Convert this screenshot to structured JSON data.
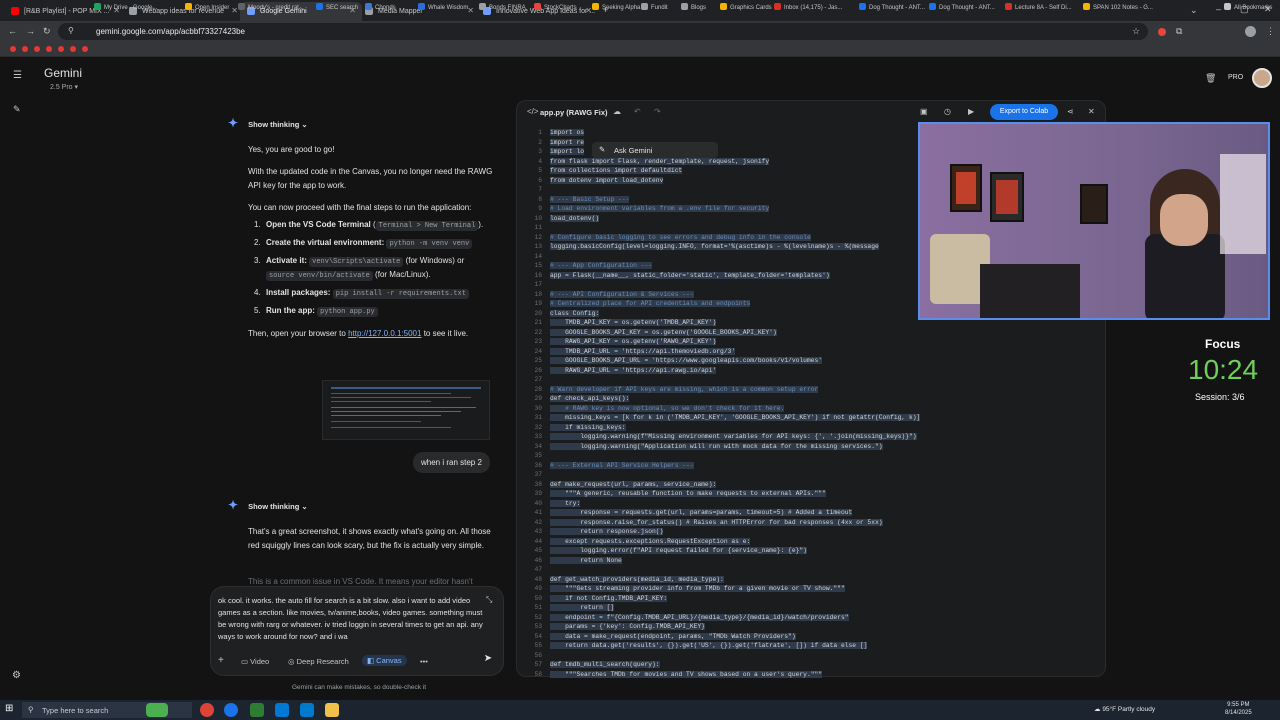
{
  "browser": {
    "tabs": [
      {
        "label": "[R&B Playlist] - POP MIX ...",
        "active": false
      },
      {
        "label": "Webapp ideas for revenue",
        "active": false
      },
      {
        "label": "Google Gemini",
        "active": true
      },
      {
        "label": "Media Mapper",
        "active": false
      },
      {
        "label": "Innovative Web App Ideas for ...",
        "active": false
      }
    ],
    "url": "gemini.google.com/app/acbbf73327423be",
    "bookmarks": [
      "My Drive - Google...",
      "Open Insider",
      "Moody's - credit rat...",
      "SEC search",
      "Cbonds",
      "Whale Wisdom",
      "Bonds FINRA",
      "StockCharts",
      "Seeking Alpha",
      "Fundit",
      "Blogs",
      "Graphics Cards",
      "Inbox (14,175) - Jas...",
      "Dog Thought - ANT...",
      "Dog Thought - ANT...",
      "Lecture 8A - Self Di...",
      "SPAN 102 Notes - G..."
    ],
    "all_bookmarks": "All Bookmarks"
  },
  "gemini": {
    "title": "Gemini",
    "model": "2.5 Pro",
    "pro_badge": "PRO",
    "show_thinking": "Show thinking",
    "intro_1": "Yes, you are good to go!",
    "intro_2": "With the updated code in the Canvas, you no longer need the RAWG API key for the app to work.",
    "intro_3": "You can now proceed with the final steps to run the application:",
    "steps": [
      {
        "n": "1.",
        "label": "Open the VS Code Terminal",
        "tail": " (",
        "code": "Terminal > New Terminal",
        "end": ")."
      },
      {
        "n": "2.",
        "label": "Create the virtual environment:",
        "tail": " ",
        "code": "python -m venv venv",
        "end": ""
      },
      {
        "n": "3.",
        "label": "Activate it:",
        "tail": " ",
        "code": "venv\\Scripts\\activate",
        "end": " (for Windows) or"
      },
      {
        "n": "",
        "label": "",
        "tail": "",
        "code": "source venv/bin/activate",
        "end": " (for Mac/Linux)."
      },
      {
        "n": "4.",
        "label": "Install packages:",
        "tail": " ",
        "code": "pip install -r requirements.txt",
        "end": ""
      },
      {
        "n": "5.",
        "label": "Run the app:",
        "tail": " ",
        "code": "python app.py",
        "end": ""
      }
    ],
    "then_text": "Then, open your browser to ",
    "then_link": "http://127.0.0.1:5001",
    "then_end": " to see it live.",
    "user_message": "when i ran step 2",
    "reply_1": "That's a great screenshot, it shows exactly what's going on. All those red squiggly lines can look scary, but the fix is actually very simple.",
    "reply_2": "This is a common issue in VS Code. It means your editor hasn't",
    "input_value": "ok cool. it works. the auto fill for search is a bit slow. also i want to add video games as a section. like movies, tv/anime,books, video games. something must be wrong with rarg or whatever. iv tried loggin in several times to get an api. any ways to work around for now? and i wa",
    "tools": {
      "video": "Video",
      "deep_research": "Deep Research",
      "canvas": "Canvas",
      "more": "•••"
    },
    "disclaimer": "Gemini can make mistakes, so double-check it"
  },
  "canvas": {
    "title": "app.py (RAWG Fix)",
    "export_label": "Export to Colab",
    "ask_gemini": "Ask Gemini",
    "code_lines": [
      {
        "n": "1",
        "t": "import os",
        "c": false
      },
      {
        "n": "2",
        "t": "import re",
        "c": false
      },
      {
        "n": "3",
        "t": "import lo",
        "c": false
      },
      {
        "n": "4",
        "t": "from flask import Flask, render_template, request, jsonify",
        "c": false
      },
      {
        "n": "5",
        "t": "from collections import defaultdict",
        "c": false
      },
      {
        "n": "6",
        "t": "from dotenv import load_dotenv",
        "c": false
      },
      {
        "n": "7",
        "t": "",
        "c": false
      },
      {
        "n": "8",
        "t": "# --- Basic Setup ---",
        "c": true
      },
      {
        "n": "9",
        "t": "# Load environment variables from a .env file for security",
        "c": true
      },
      {
        "n": "10",
        "t": "load_dotenv()",
        "c": false
      },
      {
        "n": "11",
        "t": "",
        "c": false
      },
      {
        "n": "12",
        "t": "# Configure basic logging to see errors and debug info in the console",
        "c": true
      },
      {
        "n": "13",
        "t": "logging.basicConfig(level=logging.INFO, format='%(asctime)s - %(levelname)s - %(message",
        "c": false
      },
      {
        "n": "14",
        "t": "",
        "c": false
      },
      {
        "n": "15",
        "t": "# --- App Configuration ---",
        "c": true
      },
      {
        "n": "16",
        "t": "app = Flask(__name__, static_folder='static', template_folder='templates')",
        "c": false
      },
      {
        "n": "17",
        "t": "",
        "c": false
      },
      {
        "n": "18",
        "t": "# --- API Configuration & Services ---",
        "c": true
      },
      {
        "n": "19",
        "t": "# Centralized place for API credentials and endpoints",
        "c": true
      },
      {
        "n": "20",
        "t": "class Config:",
        "c": false
      },
      {
        "n": "21",
        "t": "    TMDB_API_KEY = os.getenv('TMDB_API_KEY')",
        "c": false
      },
      {
        "n": "22",
        "t": "    GOOGLE_BOOKS_API_KEY = os.getenv('GOOGLE_BOOKS_API_KEY')",
        "c": false
      },
      {
        "n": "23",
        "t": "    RAWG_API_KEY = os.getenv('RAWG_API_KEY')",
        "c": false
      },
      {
        "n": "24",
        "t": "    TMDB_API_URL = 'https://api.themoviedb.org/3'",
        "c": false
      },
      {
        "n": "25",
        "t": "    GOOGLE_BOOKS_API_URL = 'https://www.googleapis.com/books/v1/volumes'",
        "c": false
      },
      {
        "n": "26",
        "t": "    RAWG_API_URL = 'https://api.rawg.io/api'",
        "c": false
      },
      {
        "n": "27",
        "t": "",
        "c": false
      },
      {
        "n": "28",
        "t": "# Warn developer if API keys are missing, which is a common setup error",
        "c": true
      },
      {
        "n": "29",
        "t": "def check_api_keys():",
        "c": false
      },
      {
        "n": "30",
        "t": "    # RAWG key is now optional, so we don't check for it here.",
        "c": true
      },
      {
        "n": "31",
        "t": "    missing_keys = [k for k in ('TMDB_API_KEY', 'GOOGLE_BOOKS_API_KEY') if not getattr(Config, k)]",
        "c": false
      },
      {
        "n": "32",
        "t": "    if missing_keys:",
        "c": false
      },
      {
        "n": "33",
        "t": "        logging.warning(f\"Missing environment variables for API keys: {', '.join(missing_keys)}\")",
        "c": false
      },
      {
        "n": "34",
        "t": "        logging.warning(\"Application will run with mock data for the missing services.\")",
        "c": false
      },
      {
        "n": "35",
        "t": "",
        "c": false
      },
      {
        "n": "36",
        "t": "# --- External API Service Helpers ---",
        "c": true
      },
      {
        "n": "37",
        "t": "",
        "c": false
      },
      {
        "n": "38",
        "t": "def make_request(url, params, service_name):",
        "c": false
      },
      {
        "n": "39",
        "t": "    \"\"\"A generic, reusable function to make requests to external APIs.\"\"\"",
        "c": false
      },
      {
        "n": "40",
        "t": "    try:",
        "c": false
      },
      {
        "n": "41",
        "t": "        response = requests.get(url, params=params, timeout=5) # Added a timeout",
        "c": false
      },
      {
        "n": "42",
        "t": "        response.raise_for_status() # Raises an HTTPError for bad responses (4xx or 5xx)",
        "c": false
      },
      {
        "n": "43",
        "t": "        return response.json()",
        "c": false
      },
      {
        "n": "44",
        "t": "    except requests.exceptions.RequestException as e:",
        "c": false
      },
      {
        "n": "45",
        "t": "        logging.error(f\"API request failed for {service_name}: {e}\")",
        "c": false
      },
      {
        "n": "46",
        "t": "        return None",
        "c": false
      },
      {
        "n": "47",
        "t": "",
        "c": false
      },
      {
        "n": "48",
        "t": "def get_watch_providers(media_id, media_type):",
        "c": false
      },
      {
        "n": "49",
        "t": "    \"\"\"Gets streaming provider info from TMDb for a given movie or TV show.\"\"\"",
        "c": false
      },
      {
        "n": "50",
        "t": "    if not Config.TMDB_API_KEY:",
        "c": false
      },
      {
        "n": "51",
        "t": "        return []",
        "c": false
      },
      {
        "n": "52",
        "t": "    endpoint = f\"{Config.TMDB_API_URL}/{media_type}/{media_id}/watch/providers\"",
        "c": false
      },
      {
        "n": "53",
        "t": "    params = {'key': Config.TMDB_API_KEY}",
        "c": false
      },
      {
        "n": "54",
        "t": "    data = make_request(endpoint, params, \"TMDb Watch Providers\")",
        "c": false
      },
      {
        "n": "55",
        "t": "    return data.get('results', {}).get('US', {}).get('flatrate', []) if data else []",
        "c": false
      },
      {
        "n": "56",
        "t": "",
        "c": false
      },
      {
        "n": "57",
        "t": "def tmdb_multi_search(query):",
        "c": false
      },
      {
        "n": "58",
        "t": "    \"\"\"Searches TMDb for movies and TV shows based on a user's query.\"\"\"",
        "c": false
      }
    ]
  },
  "focus": {
    "label": "Focus",
    "time": "10:24",
    "session": "Session: 3/6"
  },
  "taskbar": {
    "search_placeholder": "Type here to search",
    "weather": "95°F  Partly cloudy",
    "time": "9:55 PM",
    "date": "8/14/2025"
  },
  "colors": {
    "accent": "#1a73e8",
    "focus_green": "#6fd05c",
    "sparkle": "#6f9cff"
  }
}
